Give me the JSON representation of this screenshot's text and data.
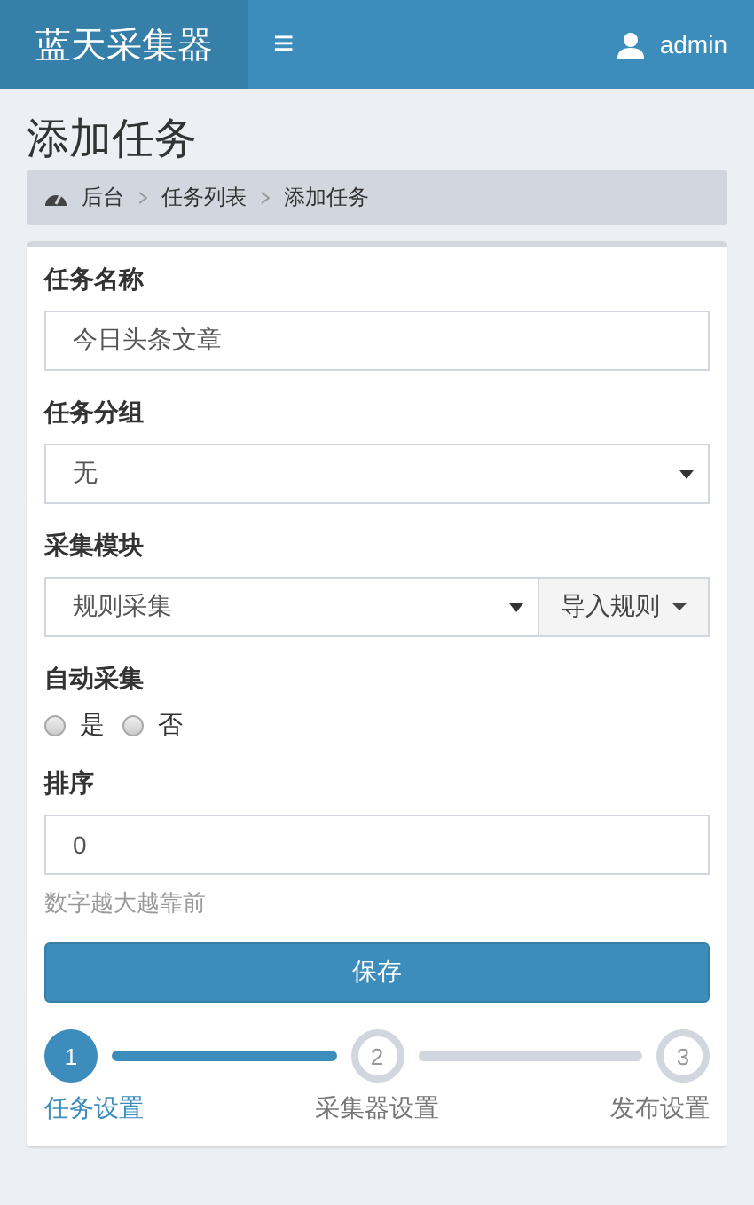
{
  "header": {
    "brand": "蓝天采集器",
    "menu_icon": "≡",
    "user": "admin"
  },
  "page_title": "添加任务",
  "breadcrumb": [
    "后台",
    "任务列表",
    "添加任务"
  ],
  "form": {
    "fields": [
      {
        "kind": "text",
        "label": "任务名称",
        "value": "今日头条文章"
      },
      {
        "kind": "select",
        "label": "任务分组",
        "value": "无"
      },
      {
        "kind": "select_button",
        "label": "采集模块",
        "value": "规则采集",
        "button": "导入规则"
      },
      {
        "kind": "radio",
        "label": "自动采集",
        "options": [
          {
            "label": "是",
            "selected": false
          },
          {
            "label": "否",
            "selected": false
          }
        ]
      },
      {
        "kind": "text",
        "label": "排序",
        "value": "0",
        "help": "数字越大越靠前"
      }
    ],
    "submit": "保存"
  },
  "steps": [
    {
      "number": "1",
      "label": "任务设置",
      "active": true
    },
    {
      "number": "2",
      "label": "采集器设置",
      "active": false
    },
    {
      "number": "3",
      "label": "发布设置",
      "active": false
    }
  ],
  "connectors": [
    {
      "active": true
    },
    {
      "active": false
    }
  ]
}
